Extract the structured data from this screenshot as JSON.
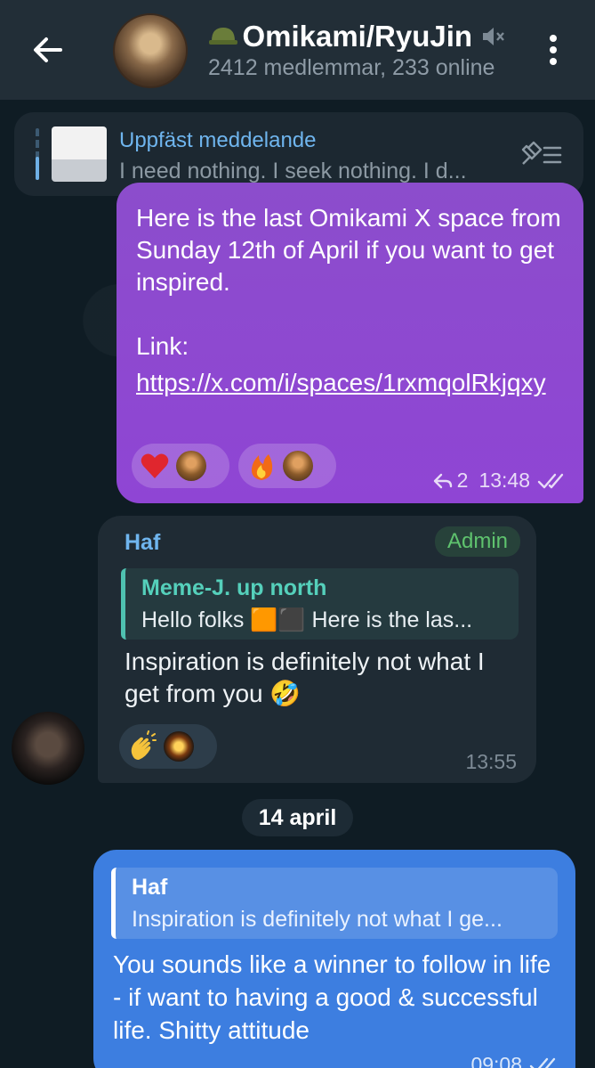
{
  "header": {
    "back_label": "Tillbaka",
    "title": "Omikami/RyuJin",
    "subtitle": "2412 medlemmar, 233 online"
  },
  "pinned": {
    "title": "Uppfäst meddelande",
    "text": "I need nothing. I seek nothing. I d..."
  },
  "messages": [
    {
      "text": "Here is the last Omikami X space from Sunday 12th of April if you want to get inspired.\n\nLink:",
      "link": "https://x.com/i/spaces/1rxmqolRkjqxy",
      "reactions": [
        "heart",
        "fire"
      ],
      "reply_count": "2",
      "time": "13:48"
    },
    {
      "sender": "Haf",
      "badge": "Admin",
      "quote_name": "Meme-J. up north",
      "quote_text": "Hello folks 🟧⬛ Here is the las...",
      "text": "Inspiration is definitely not what I get from you 🤣",
      "reaction": "clap",
      "time": "13:55"
    },
    {
      "quote_name": "Haf",
      "quote_text": "Inspiration is definitely not what I ge...",
      "text": "You sounds like a winner to follow in life - if want to having a good & successful life. Shitty attitude",
      "time": "09:08"
    }
  ],
  "date_separator": "14 april",
  "colors": {
    "header_bg": "#222e37",
    "outgoing_purple": "#8f45d4",
    "outgoing_blue": "#3d7ee0",
    "incoming": "#1f2b34",
    "accent_link": "#6fb5ee",
    "admin_green": "#5fc36e"
  },
  "icons": [
    "back-arrow-icon",
    "mute-icon",
    "more-vert-icon",
    "pin-list-icon",
    "reply-icon",
    "double-check-icon"
  ]
}
